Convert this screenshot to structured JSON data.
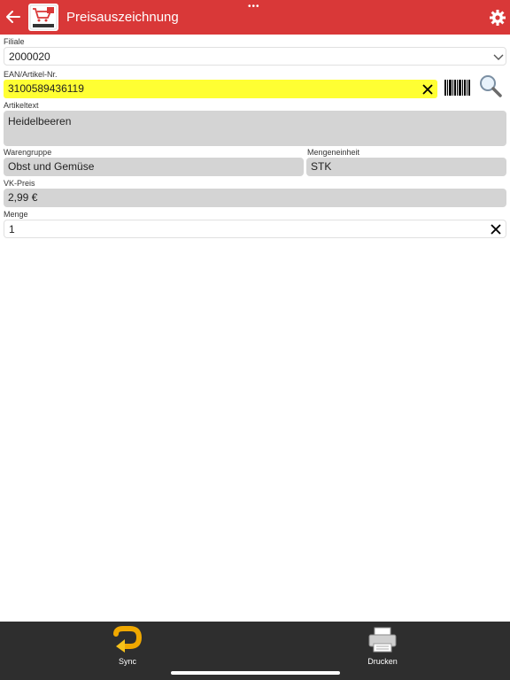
{
  "header": {
    "title": "Preisauszeichnung",
    "grabber": "•••",
    "back_icon": "arrow-left-icon",
    "settings_icon": "gear-icon",
    "logo_icon": "shopping-cart-logo"
  },
  "form": {
    "filiale": {
      "label": "Filiale",
      "value": "2000020"
    },
    "ean": {
      "label": "EAN/Artikel-Nr.",
      "value": "3100589436119"
    },
    "artikeltext": {
      "label": "Artikeltext",
      "value": "Heidelbeeren"
    },
    "warengruppe": {
      "label": "Warengruppe",
      "value": "Obst und Gemüse"
    },
    "mengeneinheit": {
      "label": "Mengeneinheit",
      "value": "STK"
    },
    "vk_preis": {
      "label": "VK-Preis",
      "value": "2,99 €"
    },
    "menge": {
      "label": "Menge",
      "value": "1"
    }
  },
  "toolbar": {
    "sync_label": "Sync",
    "print_label": "Drucken"
  },
  "colors": {
    "header": "#d93838",
    "highlight": "#ffff33",
    "readonly": "#d4d4d4",
    "toolbar": "#2e2e2e"
  }
}
